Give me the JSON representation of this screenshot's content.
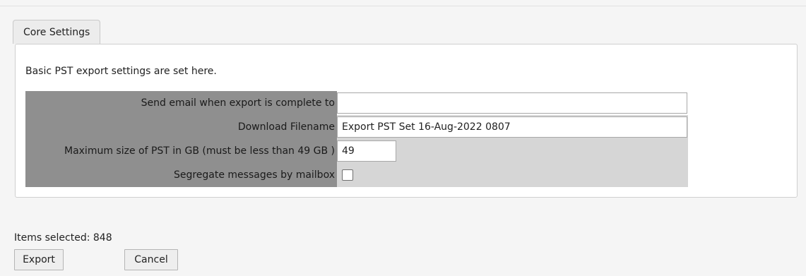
{
  "tab": {
    "label": "Core Settings"
  },
  "description": "Basic PST export settings are set here.",
  "fields": {
    "email": {
      "label": "Send email when export is complete to",
      "value": ""
    },
    "filename": {
      "label": "Download Filename",
      "value": "Export PST Set 16-Aug-2022 0807"
    },
    "max_size": {
      "label": "Maximum size of PST in GB (must be less than 49 GB )",
      "value": "49"
    },
    "segregate": {
      "label": "Segregate messages by mailbox",
      "checked": false
    }
  },
  "footer": {
    "items_selected": "Items selected: 848",
    "export_label": "Export",
    "cancel_label": "Cancel"
  }
}
